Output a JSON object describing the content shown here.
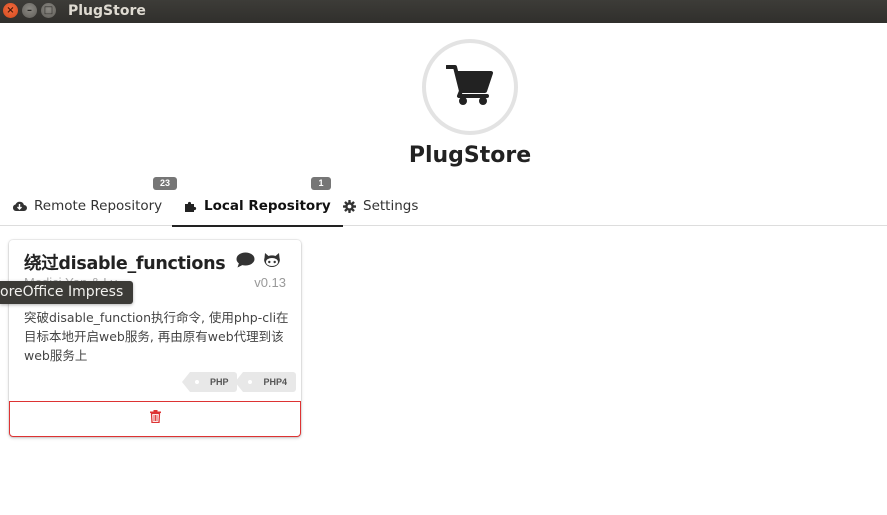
{
  "window": {
    "title": "PlugStore",
    "close_glyph": "×",
    "minimize_glyph": "–",
    "maximize_glyph": "□"
  },
  "header": {
    "logo_icon": "shopping-cart-icon",
    "title": "PlugStore"
  },
  "tabs": [
    {
      "label": "Remote Repository",
      "icon": "cloud-download-icon",
      "count": "23",
      "active": false
    },
    {
      "label": "Local Repository",
      "icon": "puzzle-piece-icon",
      "count": "1",
      "active": true
    },
    {
      "label": "Settings",
      "icon": "gear-icon",
      "active": false
    }
  ],
  "plugins": [
    {
      "title": "绕过disable_functions",
      "author": "Medici.Yan & Lv",
      "version": "v0.13",
      "description": "突破disable_function执行命令, 使用php-cli在目标本地开启web服务, 再由原有web代理到该web服务上",
      "tags": [
        "PHP",
        "PHP4"
      ],
      "icons": [
        "comment-icon",
        "github-icon"
      ]
    }
  ],
  "tooltip": {
    "text": "oreOffice Impress"
  },
  "colors": {
    "titlebar": "#3c3b37",
    "danger": "#dd3333",
    "badge": "#767676",
    "tag_bg": "#e8e8e8"
  }
}
